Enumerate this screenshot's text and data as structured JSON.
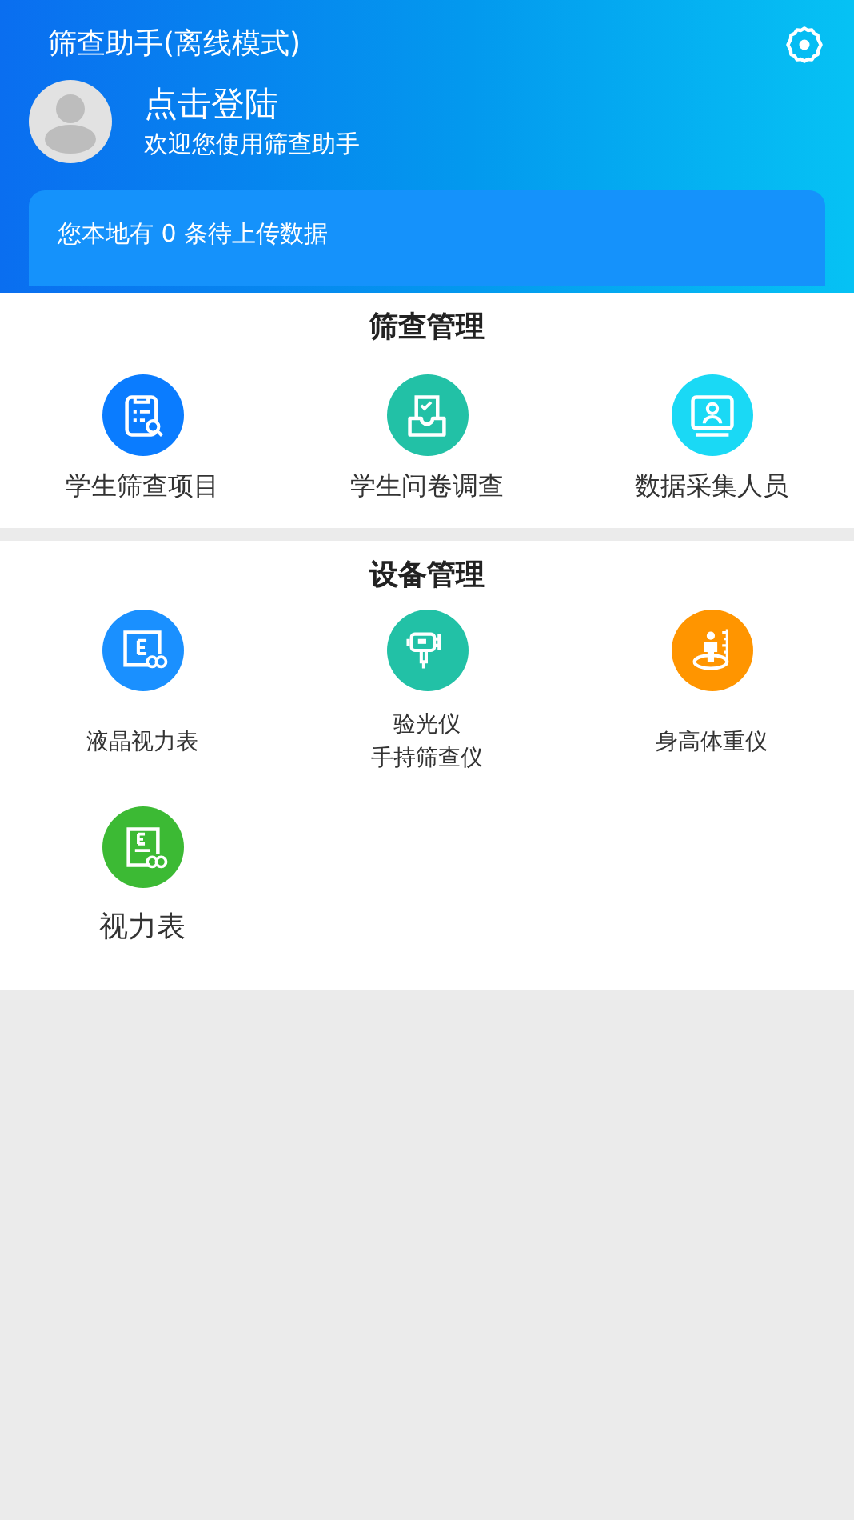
{
  "header": {
    "title": "筛查助手(离线模式)",
    "login": "点击登陆",
    "welcome": "欢迎您使用筛查助手",
    "pending": "您本地有 0 条待上传数据"
  },
  "sections": [
    {
      "title": "筛查管理",
      "items": [
        {
          "kind": "clipboard-search",
          "color": "#0a7cff",
          "lines": [
            "学生筛查项目"
          ],
          "large": false
        },
        {
          "kind": "inbox-check",
          "color": "#22c1a6",
          "lines": [
            "学生问卷调查"
          ],
          "large": false
        },
        {
          "kind": "monitor-person",
          "color": "#1ad9f5",
          "lines": [
            "数据采集人员"
          ],
          "large": false
        }
      ]
    },
    {
      "title": "设备管理",
      "items": [
        {
          "kind": "screen-chart",
          "color": "#1a90ff",
          "lines": [
            "液晶视力表"
          ],
          "large": false
        },
        {
          "kind": "handheld",
          "color": "#22c1a6",
          "lines": [
            "验光仪",
            "手持筛查仪"
          ],
          "large": false
        },
        {
          "kind": "height-scale",
          "color": "#ff9500",
          "lines": [
            "身高体重仪"
          ],
          "large": false
        },
        {
          "kind": "eye-chart",
          "color": "#3cba34",
          "lines": [
            "视力表"
          ],
          "large": true
        }
      ]
    }
  ]
}
